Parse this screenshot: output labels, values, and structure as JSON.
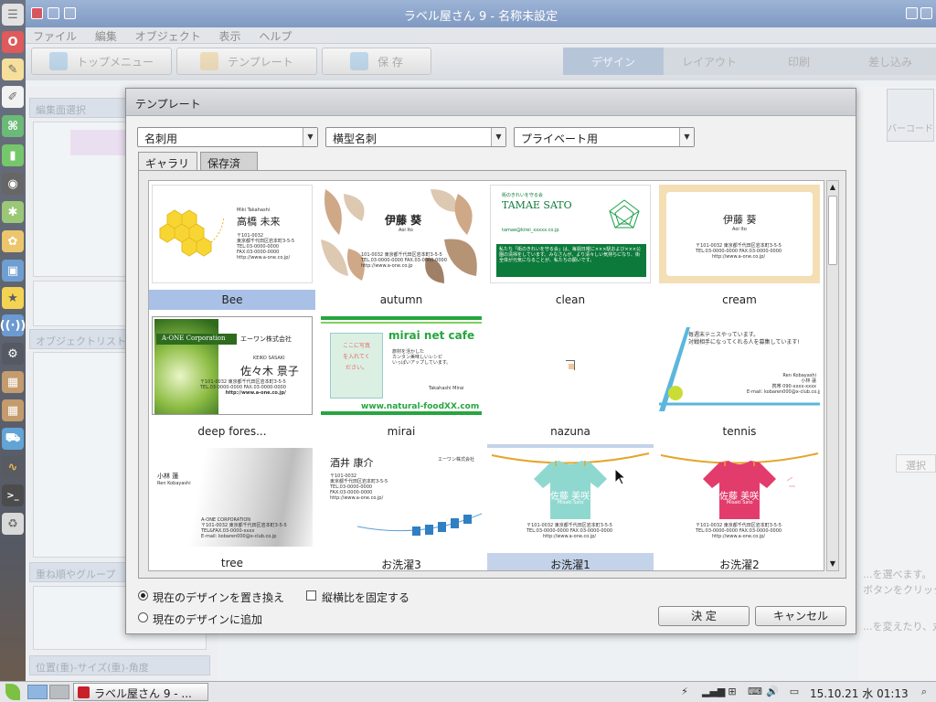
{
  "window": {
    "title": "ラベル屋さん 9 - 名称未設定"
  },
  "menu": [
    "ファイル",
    "編集",
    "オブジェクト",
    "表示",
    "ヘルプ"
  ],
  "toolbar": {
    "top_menu": "トップメニュー",
    "template": "テンプレート",
    "save": "保 存"
  },
  "steps": [
    "デザイン",
    "レイアウト",
    "印刷",
    "差し込み"
  ],
  "left_panel": {
    "edit_area": "編集面選択",
    "object_list": "オブジェクトリスト",
    "sort_group": "重ね順やグループ",
    "position": "位置(重)-サイズ(重)-角度"
  },
  "right_panel": {
    "barcode": "バーコード",
    "select": "選択"
  },
  "background_text": [
    "...を選べます。",
    "ボタンをクリック",
    "...を変えたり、丸い"
  ],
  "dialog": {
    "title": "テンプレート",
    "dropdowns": [
      "名刺用",
      "横型名刺",
      "プライベート用"
    ],
    "tabs": [
      "ギャラリー",
      "保存済み"
    ],
    "gallery": [
      {
        "name": "Bee",
        "card": {
          "romaji": "Miki Takahashi",
          "jp": "高橋 未来",
          "lines": [
            "〒101-0032",
            "東京都千代田区岩本町3-5-5",
            "TEL:03-0000-0000",
            "FAX:03-0000-0000",
            "http://www.a-one.co.jp/"
          ]
        }
      },
      {
        "name": "autumn",
        "card": {
          "jp": "伊藤 葵",
          "romaji": "Aoi Ito",
          "lines": [
            "101-0032 東京都千代田区岩本町3-5-5",
            "TEL.03-0000-0000 FAX.03-0000-0000",
            "http://www.a-one.co.jp"
          ]
        }
      },
      {
        "name": "clean",
        "card": {
          "small": "街のきれいを守る会",
          "name": "TAMAE SATO",
          "email": "tamae@kirei_xxxxx.co.jp",
          "msg": "私たち「街のきれいを守る会」は、毎週日曜に×××駅および×××公園の清掃をしています。みなさんが、より清々しい気持ちになり、街全体が元気になることが、私たちの願いです。"
        }
      },
      {
        "name": "cream",
        "card": {
          "jp": "伊藤 葵",
          "romaji": "Aoi Ito",
          "lines": [
            "〒101-0032 東京都千代田区岩本町3-5-5",
            "TEL:03-0000-0000 FAX:03-0000-0000",
            "http://www.a-one.co.jp/"
          ]
        }
      },
      {
        "name": "deep fores...",
        "card": {
          "company_en": "A-ONE Corporation",
          "company_jp": "エーワン株式会社",
          "romaji": "KEIKO SASAKI",
          "jp": "佐々木 景子",
          "lines": [
            "〒101-0032 東京都千代田区岩本町3-5-5",
            "TEL.03-0000-0000 FAX.03-0000-0000",
            "http://www.a-one.co.jp/"
          ]
        }
      },
      {
        "name": "mirai",
        "card": {
          "title": "mirai net cafe",
          "note": "ここに写真を入れてください。",
          "copy": [
            "旅材を活かした",
            "カンタン美味しいレシピ",
            "いっぱいアップしています。"
          ],
          "sign": "Takahashi Mirai",
          "url": "www.natural-foodXX.com"
        }
      },
      {
        "name": "nazuna",
        "card": {}
      },
      {
        "name": "tennis",
        "card": {
          "msg1": "毎週末テニスやっています。",
          "msg2": "対戦相手になってくれる人を募集しています!",
          "romaji": "Ren Kobayashi",
          "jp": "小林 蓮",
          "lines": [
            "携帯 090-xxxx-xxxx",
            "E-mail: kobaren000@x-club.co.jp"
          ]
        }
      },
      {
        "name": "tree",
        "card": {
          "jp": "小林 蓮",
          "romaji": "Ren Kobayashi",
          "company": "A-ONE CORPORATION",
          "lines": [
            "〒101-0032 東京都千代田区岩本町3-5-5",
            "TEL&FAX.03-0000-xxxx",
            "E-mail: kobaren000@x-club.co.jp"
          ]
        }
      },
      {
        "name": "お洗濯3",
        "card": {
          "jp": "酒井 康介",
          "company": "エーワン株式会社",
          "lines": [
            "〒101-0032",
            "東京都千代田区岩本町3-5-5",
            "TEL:03-0000-0000",
            "FAX:03-0000-0000",
            "http://www.a-one.co.jp/"
          ]
        }
      },
      {
        "name": "お洗濯1",
        "card": {
          "jp": "佐藤 美咲",
          "romaji": "Misaki Sato",
          "lines": [
            "〒101-0032 東京都千代田区岩本町3-5-5",
            "TEL:03-0000-0000 FAX:03-0000-0000",
            "http://www.a-one.co.jp/"
          ]
        }
      },
      {
        "name": "お洗濯2",
        "card": {
          "jp": "佐藤 美咲",
          "romaji": "Misaki Sato",
          "lines": [
            "〒101-0032 東京都千代田区岩本町3-5-5",
            "TEL:03-0000-0000 FAX:03-0000-0000",
            "http://www.a-one.co.jp/"
          ]
        }
      }
    ],
    "options": {
      "replace": "現在のデザインを置き換え",
      "add": "現在のデザインに追加",
      "lock_ratio": "縦横比を固定する"
    },
    "buttons": {
      "ok": "決 定",
      "cancel": "キャンセル"
    }
  },
  "taskbar": {
    "app": "ラベル屋さん 9 - ...",
    "clock": "15.10.21 水 01:13"
  },
  "colors": {
    "title_bar": "#5f80b4",
    "selection": "#c4d3e9",
    "clean_green": "#0c7a3a",
    "bee_yellow": "#f7d633",
    "mirai_green": "#26a640",
    "tshirt_teal": "#8fd8cf",
    "tshirt_pink": "#e23c6c",
    "hanger_line": "#e5a52a"
  }
}
